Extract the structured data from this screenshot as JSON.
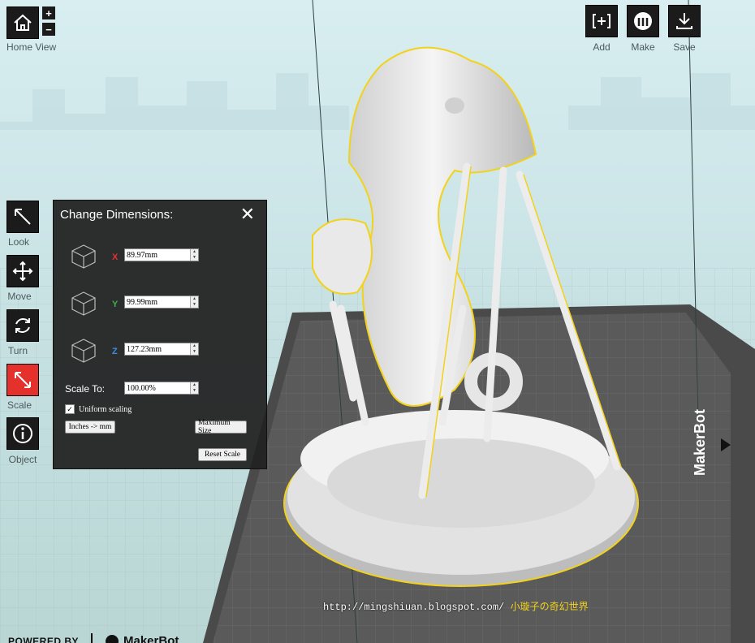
{
  "toolbar_top_left": {
    "home_label": "Home View",
    "zoom_in": "+",
    "zoom_out": "−"
  },
  "toolbar_top_right": [
    {
      "label": "Add",
      "icon": "add-icon"
    },
    {
      "label": "Make",
      "icon": "makerbot-m-icon"
    },
    {
      "label": "Save",
      "icon": "download-icon"
    }
  ],
  "toolbar_left": [
    {
      "label": "Look",
      "icon": "look-arrow-icon"
    },
    {
      "label": "Move",
      "icon": "move-cross-icon"
    },
    {
      "label": "Turn",
      "icon": "rotate-icon"
    },
    {
      "label": "Scale",
      "icon": "scale-arrow-icon",
      "active": true
    },
    {
      "label": "Object",
      "icon": "info-icon"
    }
  ],
  "dimensions_panel": {
    "title": "Change Dimensions:",
    "close": "✕",
    "x": {
      "letter": "X",
      "value": "89.97mm",
      "color": "#e4312c"
    },
    "y": {
      "letter": "Y",
      "value": "99.99mm",
      "color": "#3cb04a"
    },
    "z": {
      "letter": "Z",
      "value": "127.23mm",
      "color": "#3b8fe0"
    },
    "scale_label": "Scale To:",
    "scale_value": "100.00%",
    "uniform_label": "Uniform scaling",
    "inches_button": "Inches -> mm",
    "maximum_button": "Maximum Size",
    "reset_button": "Reset Scale"
  },
  "plate_brand": "MakerBot",
  "watermark": {
    "url": "http://mingshiuan.blogspot.com/",
    "name": "小璇子の奇幻世界"
  },
  "footer": {
    "powered_by": "POWERED BY",
    "brand": "MakerBot"
  },
  "colors": {
    "accent": "#e4312c",
    "selection": "#f2d21b",
    "panel": "#222222"
  }
}
